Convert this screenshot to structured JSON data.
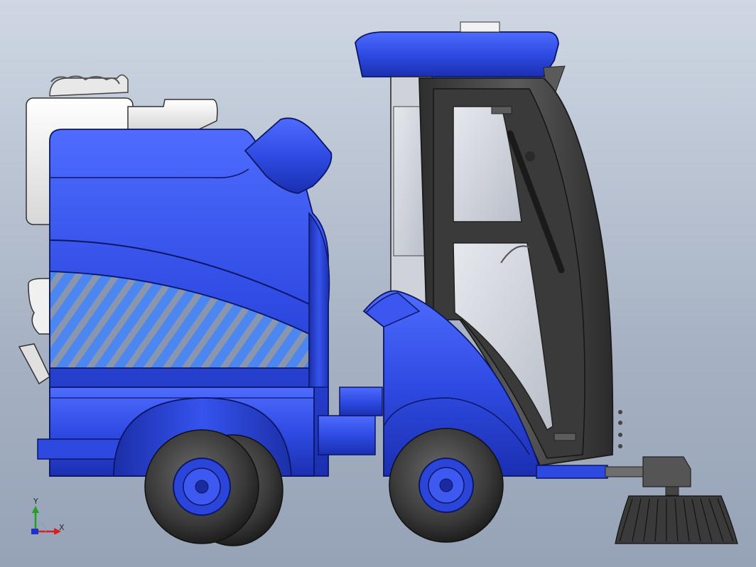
{
  "viewport": {
    "background_top": "#cfd7e3",
    "background_bottom": "#96a2b6"
  },
  "model": {
    "subject": "street-sweeper-vehicle",
    "body_color": "#2f4be3",
    "cab_frame_color": "#3a3a3a",
    "tire_color": "#3f3f3f",
    "rim_color": "#2b45d8",
    "glass_color": "#c8ccd4",
    "tank_color": "#f2f2f2",
    "hatch_stripe_color": "#8a96ad"
  },
  "triad": {
    "x_label": "X",
    "y_label": "Y",
    "x_color": "#d42020",
    "y_color": "#1fa11f",
    "z_color": "#2030d0"
  }
}
